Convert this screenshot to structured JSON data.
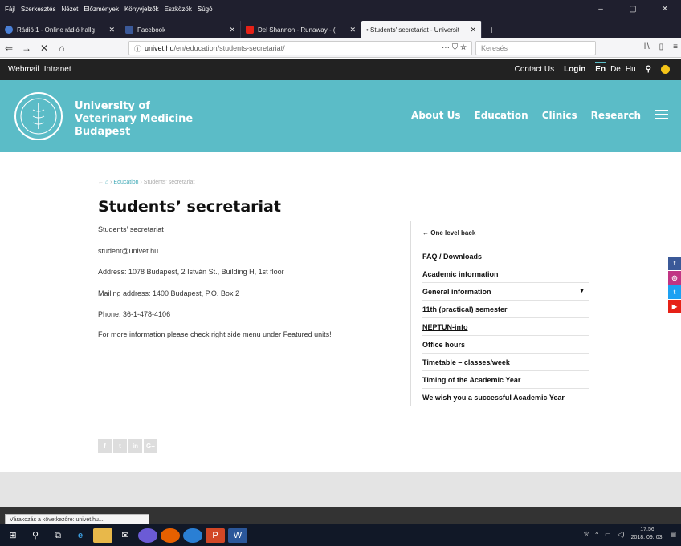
{
  "window": {
    "menu": [
      "Fájl",
      "Szerkesztés",
      "Nézet",
      "Előzmények",
      "Könyvjelzők",
      "Eszközök",
      "Súgó"
    ],
    "controls": [
      "–",
      "▢",
      "✕"
    ]
  },
  "tabs": [
    {
      "title": "Rádió 1 - Online rádió hallg",
      "icon_color": "#4a7fd6"
    },
    {
      "title": "Facebook",
      "icon_color": "#3b5998"
    },
    {
      "title": "Del Shannon - Runaway - (",
      "icon_color": "#e62117"
    },
    {
      "title": "• Students' secretariat - Universit",
      "icon_color": "#ffffff"
    }
  ],
  "nav": {
    "url_host": "univet.hu",
    "url_path": "/en/education/students-secretariat/",
    "url_icons": "··· ⛉ ☆",
    "search_placeholder": "Keresés"
  },
  "topbar": {
    "left": [
      "Webmail",
      "Intranet"
    ],
    "contact": "Contact Us",
    "login": "Login",
    "langs": [
      "En",
      "De",
      "Hu"
    ]
  },
  "header": {
    "name_lines": [
      "University of",
      "Veterinary Medicine",
      "Budapest"
    ],
    "menu": [
      "About Us",
      "Education",
      "Clinics",
      "Research"
    ]
  },
  "breadcrumb": {
    "section": "Education",
    "current": "Students' secretariat"
  },
  "page": {
    "title": "Students’ secretariat",
    "lines": [
      "Students’ secretariat",
      "student@univet.hu",
      "Address: 1078 Budapest, 2 István St., Building H, 1st floor",
      "Mailing address: 1400 Budapest, P.O. Box 2",
      "Phone: 36-1-478-4106",
      "For more information please check right side menu under Featured units!"
    ]
  },
  "sidemenu": {
    "back": "One level back",
    "items": [
      "FAQ / Downloads",
      "Academic information",
      "General information",
      "11th (practical) semester",
      "NEPTUN-info",
      "Office hours",
      "Timetable – classes/week",
      "Timing of the Academic Year",
      "We wish you a successful Academic Year"
    ]
  },
  "social_side": [
    {
      "label": "f",
      "color": "#3b5998"
    },
    {
      "label": "◎",
      "color": "#c13584"
    },
    {
      "label": "t",
      "color": "#1da1f2"
    },
    {
      "label": "▶",
      "color": "#e62117"
    }
  ],
  "social_footer": [
    "f",
    "t",
    "in",
    "G+"
  ],
  "status": "Várakozás a következőre: univet.hu...",
  "clock": {
    "time": "17:56",
    "date": "2018. 09. 03."
  }
}
